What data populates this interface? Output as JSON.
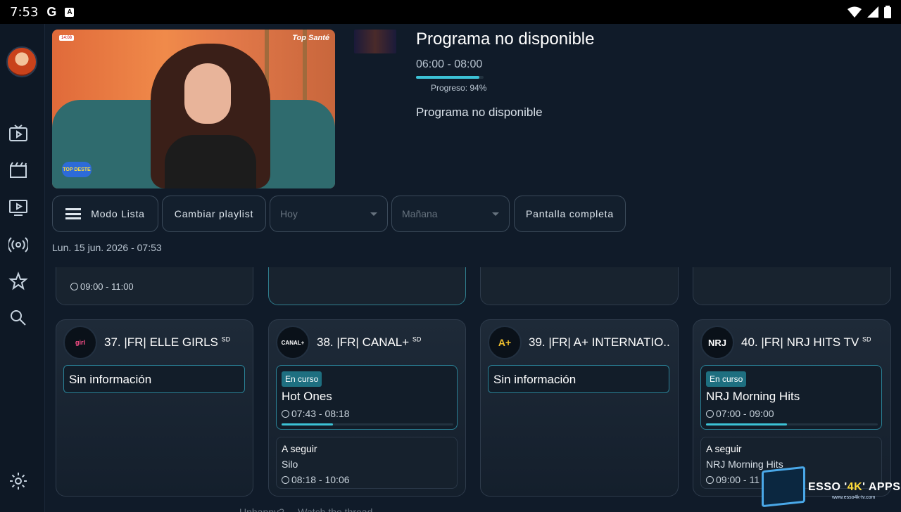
{
  "status_bar": {
    "time": "7:53",
    "google_glyph": "G",
    "a_glyph": "A"
  },
  "sidebar": {
    "avatar": "avatar",
    "items": [
      {
        "icon": "tv-icon"
      },
      {
        "icon": "movie-icon"
      },
      {
        "icon": "series-icon"
      },
      {
        "icon": "broadcast-icon"
      },
      {
        "icon": "star-icon"
      },
      {
        "icon": "search-icon"
      },
      {
        "icon": "settings-icon"
      }
    ]
  },
  "preview": {
    "channel_logo": "Top Santé",
    "clock_tag": "14:08",
    "sticker": "TOP DESTE"
  },
  "program": {
    "title": "Programa no disponible",
    "time": "06:00 - 08:00",
    "progress_label": "Progreso: 94%",
    "progress": 0.94,
    "description": "Programa no disponible"
  },
  "controls": {
    "list_mode": "Modo Lista",
    "change_playlist": "Cambiar playlist",
    "today_placeholder": "Hoy",
    "tomorrow_placeholder": "Mañana",
    "fullscreen": "Pantalla completa"
  },
  "date_line": "Lun. 15 jun. 2026 - 07:53",
  "partial_row": {
    "time": "09:00 - 11:00"
  },
  "channels": [
    {
      "name": "37. |FR| ELLE GIRLS",
      "quality": "SD",
      "logo": "girl",
      "no_info": "Sin información"
    },
    {
      "name": "38. |FR| CANAL+",
      "quality": "SD",
      "logo": "CANAL+",
      "current": {
        "badge": "En curso",
        "title": "Hot Ones",
        "time": "07:43 - 08:18",
        "progress": 0.3
      },
      "next": {
        "label": "A seguir",
        "title": "Silo",
        "time": "08:18 - 10:06"
      }
    },
    {
      "name": "39. |FR| A+ INTERNATIO..",
      "quality": "",
      "logo": "A+",
      "no_info": "Sin información"
    },
    {
      "name": "40. |FR| NRJ HITS TV",
      "quality": "SD",
      "logo": "NRJ",
      "current": {
        "badge": "En curso",
        "title": "NRJ Morning Hits",
        "time": "07:00 - 09:00",
        "progress": 0.47
      },
      "next": {
        "label": "A seguir",
        "title": "NRJ Morning Hits",
        "time": "09:00 - 11"
      }
    }
  ],
  "watermark": {
    "brand_a": "ESSO '",
    "brand_b": "4K",
    "brand_c": "' APPS",
    "url": "www.esso4k-tv.com"
  },
  "bottom_text": "Unhappy? ... Watch the thread"
}
